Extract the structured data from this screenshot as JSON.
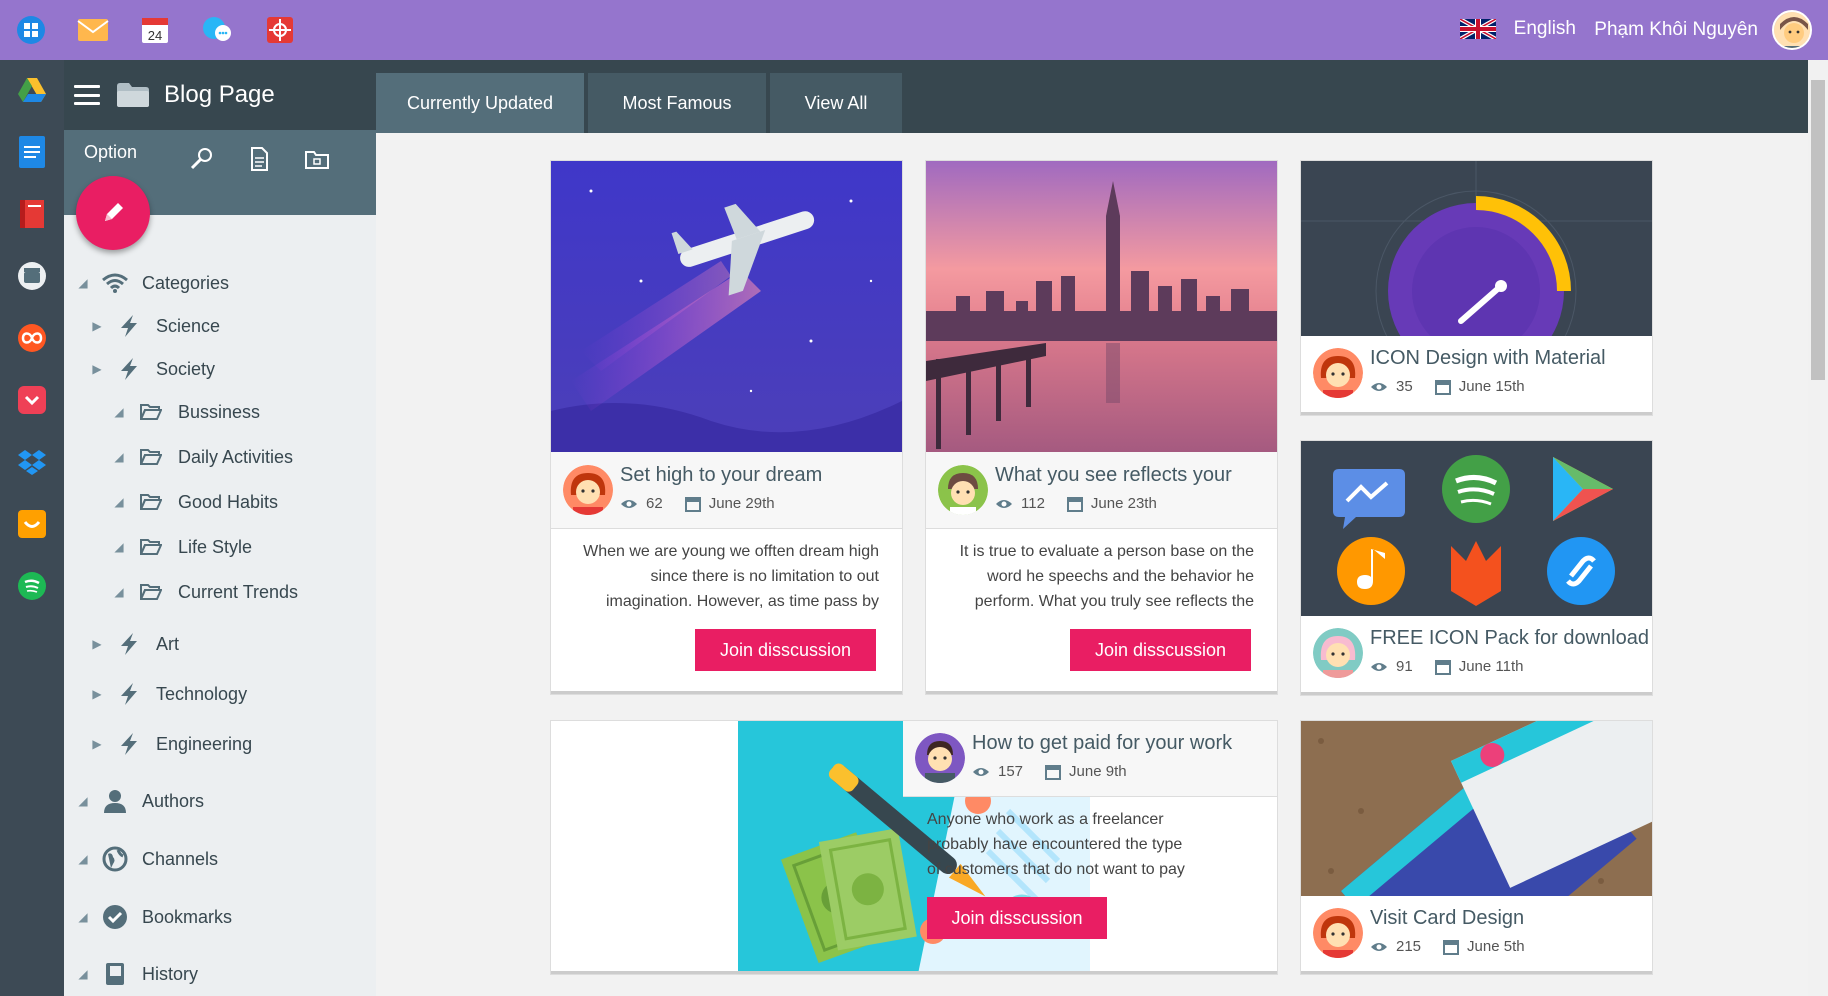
{
  "topbar": {
    "apps": [
      "windows-icon",
      "mail-icon",
      "calendar-icon",
      "chat-icon",
      "gift-icon"
    ],
    "calendar_day": "24",
    "language": "English",
    "username": "Phạm Khôi Nguyên"
  },
  "dock": [
    "drive-icon",
    "docs-icon",
    "book-icon",
    "clapper-icon",
    "infinity-icon",
    "pocket-icon",
    "dropbox-icon",
    "ikea-icon",
    "spotify-icon"
  ],
  "sidebar": {
    "title": "Blog Page",
    "option_label": "Option",
    "tree": [
      {
        "label": "Categories",
        "level": 0
      },
      {
        "label": "Science",
        "level": 1
      },
      {
        "label": "Society",
        "level": 1
      },
      {
        "label": "Bussiness",
        "level": 2
      },
      {
        "label": "Daily Activities",
        "level": 2
      },
      {
        "label": "Good Habits",
        "level": 2
      },
      {
        "label": "Life Style",
        "level": 2
      },
      {
        "label": "Current Trends",
        "level": 2
      },
      {
        "label": "Art",
        "level": 1
      },
      {
        "label": "Technology",
        "level": 1
      },
      {
        "label": "Engineering",
        "level": 1
      },
      {
        "label": "Authors",
        "level": 0
      },
      {
        "label": "Channels",
        "level": 0
      },
      {
        "label": "Bookmarks",
        "level": 0
      },
      {
        "label": "History",
        "level": 0
      }
    ]
  },
  "tabs": [
    "Currently Updated",
    "Most Famous",
    "View All"
  ],
  "posts": [
    {
      "title": "Set high to your dream",
      "views": "62",
      "date": "June 29th",
      "excerpt": "When we are young we offten dream high since there is no limitation to out imagination. However, as time pass by",
      "button": "Join disscussion"
    },
    {
      "title": "What you see reflects your",
      "views": "112",
      "date": "June 23th",
      "excerpt": "It is true to evaluate a person base on the word he speechs and the behavior he perform. What you truly see reflects the",
      "button": "Join disscussion"
    },
    {
      "title": "ICON Design with Material",
      "views": "35",
      "date": "June 15th"
    },
    {
      "title": "FREE ICON Pack for download",
      "views": "91",
      "date": "June 11th"
    },
    {
      "title": "How to get paid for your work",
      "views": "157",
      "date": "June 9th",
      "excerpt": "Anyone who work as a freelancer probably have encountered the type of customers that do not want to pay",
      "button": "Join disscussion"
    },
    {
      "title": "Visit Card Design",
      "views": "215",
      "date": "June 5th"
    }
  ],
  "colors": {
    "topbar": "#9575cd",
    "dock": "#3d4a55",
    "header": "#37474f",
    "accent": "#e91e63"
  }
}
